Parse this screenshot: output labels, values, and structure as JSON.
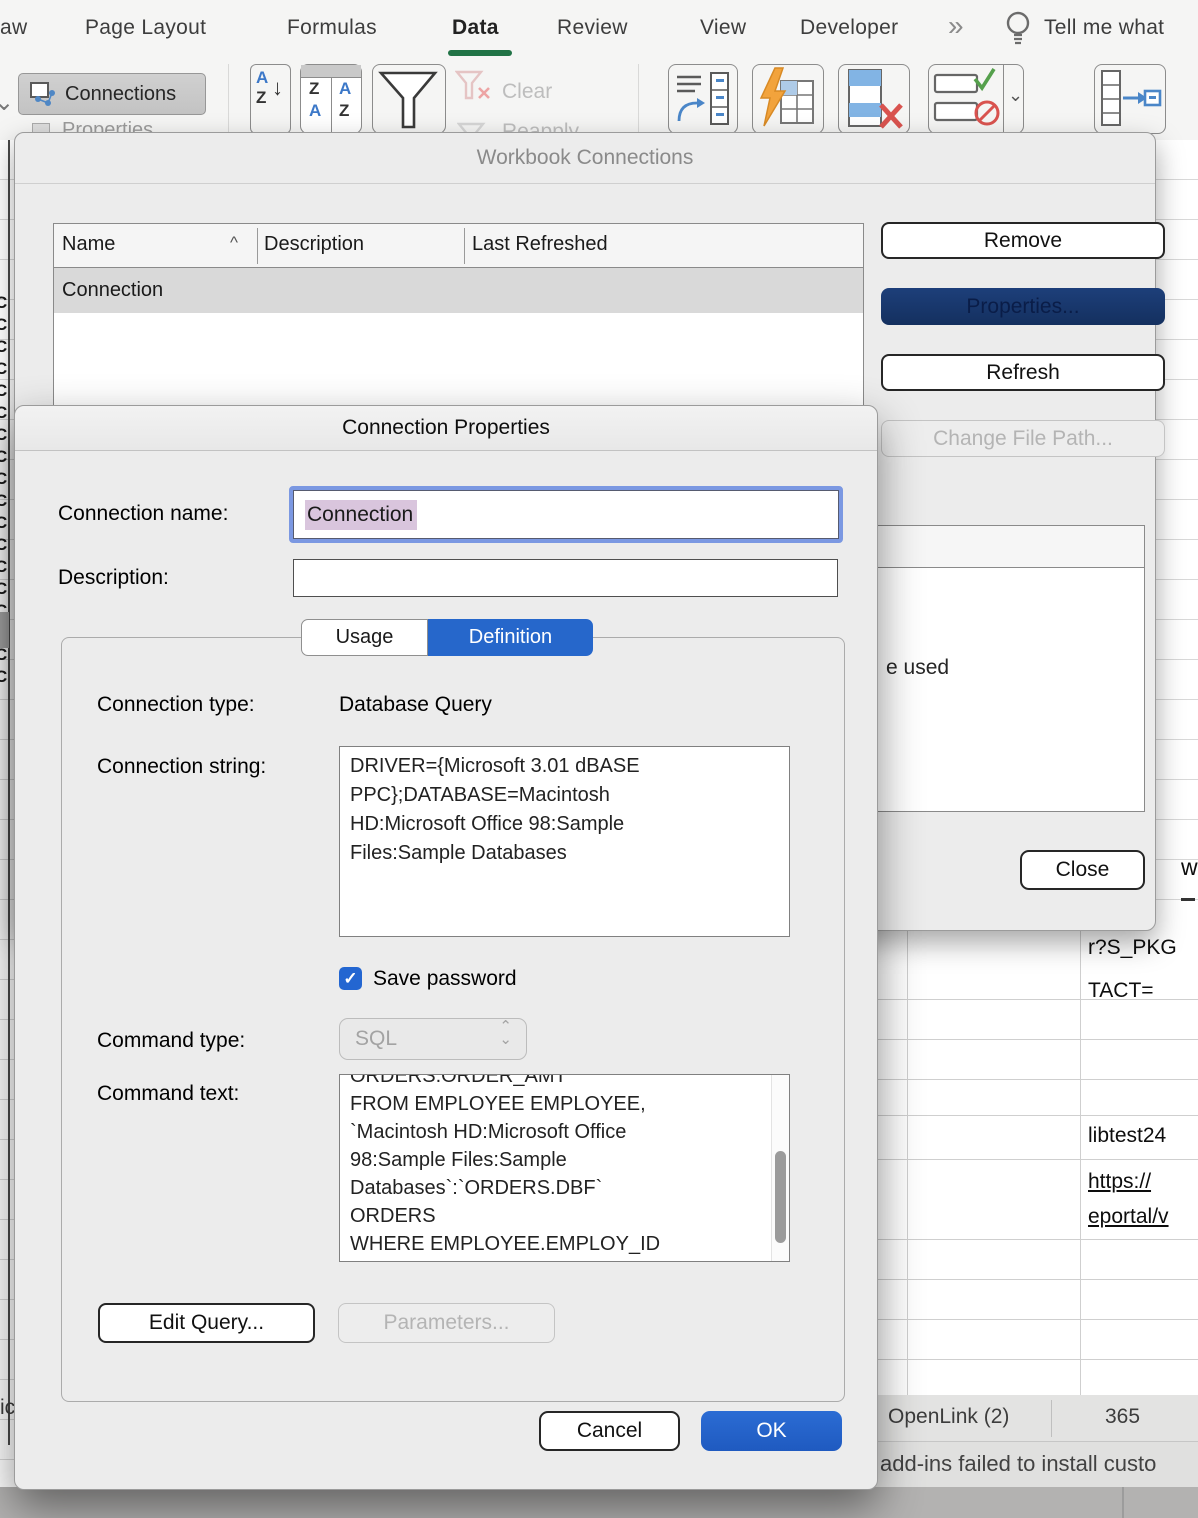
{
  "ribbon": {
    "tabs": [
      {
        "label": "aw"
      },
      {
        "label": "Page Layout"
      },
      {
        "label": "Formulas"
      },
      {
        "label": "Data"
      },
      {
        "label": "Review"
      },
      {
        "label": "View"
      },
      {
        "label": "Developer"
      }
    ],
    "active_tab": "Data",
    "overflow_chevron": "»",
    "tell_me_label": "Tell me what",
    "connections_label": "Connections",
    "properties_label": "Properties",
    "clear_label": "Clear",
    "reapply_label": "Reapply"
  },
  "workbook_connections_dialog": {
    "title": "Workbook Connections",
    "table": {
      "columns": [
        "Name",
        "Description",
        "Last Refreshed"
      ],
      "sort_indicator": "^",
      "rows": [
        "Connection"
      ]
    },
    "remove_button": "Remove",
    "properties_button": "Properties...",
    "refresh_button": "Refresh",
    "change_file_path_button": "Change File Path...",
    "close_button": "Close",
    "usage_panel_partial_text": "e used"
  },
  "connection_properties_dialog": {
    "title": "Connection Properties",
    "connection_name": {
      "label": "Connection name:",
      "value": "Connection"
    },
    "description": {
      "label": "Description:",
      "value": ""
    },
    "tabs": {
      "usage": "Usage",
      "definition": "Definition",
      "active": "Definition"
    },
    "connection_type": {
      "label": "Connection type:",
      "value": "Database Query"
    },
    "connection_string": {
      "label": "Connection string:",
      "value": "DRIVER={Microsoft 3.01 dBASE\nPPC};DATABASE=Macintosh\nHD:Microsoft Office 98:Sample\nFiles:Sample Databases"
    },
    "save_password": {
      "label": "Save password",
      "checked": true
    },
    "command_type": {
      "label": "Command type:",
      "value": "SQL"
    },
    "command_text": {
      "label": "Command text:",
      "value": "ORDERS.ORDER_AMT\nFROM EMPLOYEE EMPLOYEE,\n`Macintosh HD:Microsoft Office\n98:Sample Files:Sample\nDatabases`:`ORDERS.DBF`\nORDERS\nWHERE EMPLOYEE.EMPLOY_ID"
    },
    "edit_query_button": "Edit Query...",
    "parameters_button": "Parameters...",
    "cancel_button": "Cancel",
    "ok_button": "OK"
  },
  "background": {
    "cell_pkg": "r?S_PKG\nTACT=",
    "cell_libtest": "libtest24",
    "cell_link": "https://\neportal/v",
    "fragment_w": "w",
    "fragment_ic": "ic",
    "left_glyph_column": "CCCCCCCCCCCCCCCCCC",
    "sheet_tabs": [
      "OpenLink (2)",
      "365"
    ],
    "status_message": "add-ins failed to install custo"
  },
  "icons": {
    "check": "✓",
    "sort_a": "A",
    "sort_z": "Z",
    "arrow_down": "↓",
    "chevron_down": "⌄",
    "chevron_up": "⌃"
  },
  "colors": {
    "accent_blue": "#2264c8",
    "tab_underline_green": "#217346",
    "properties_button_navy": "#1b3c74",
    "selection_highlight": "#d9c5dd",
    "focus_ring": "#7b98e2"
  }
}
